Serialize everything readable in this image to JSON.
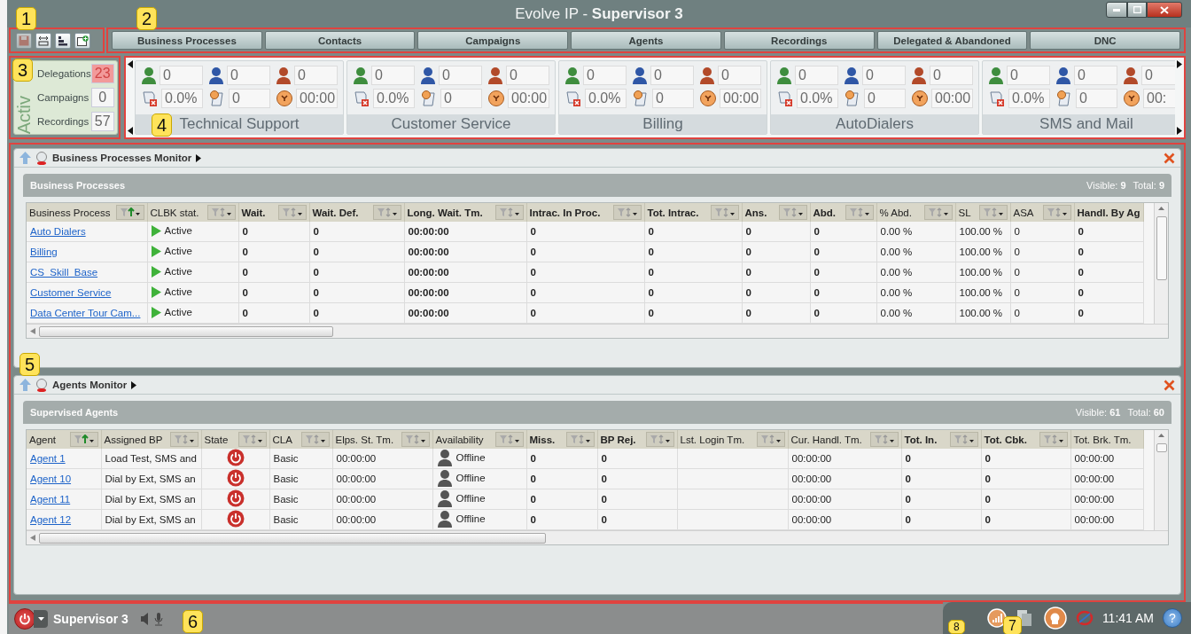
{
  "window": {
    "title": "Evolve IP - **Supervisor 3**"
  },
  "toolbar": {
    "buttons": [
      {
        "kind": "save",
        "disabled": true
      },
      {
        "kind": "fit",
        "disabled": false
      },
      {
        "kind": "bars",
        "disabled": false
      },
      {
        "kind": "new",
        "disabled": false
      }
    ]
  },
  "tabs": [
    {
      "label": "Business Processes"
    },
    {
      "label": "Contacts"
    },
    {
      "label": "Campaigns"
    },
    {
      "label": "Agents"
    },
    {
      "label": "Recordings"
    },
    {
      "label": "Delegated & Abandoned"
    },
    {
      "label": "DNC"
    }
  ],
  "active_panel": {
    "label": "Activ",
    "items": [
      {
        "label": "Delegations",
        "count": "23",
        "alert": true
      },
      {
        "label": "Campaigns",
        "count": "0",
        "alert": false
      },
      {
        "label": "Recordings",
        "count": "57",
        "alert": false
      }
    ]
  },
  "queues": [
    {
      "name": "Technical Support",
      "stats": [
        "0",
        "0",
        "0",
        "0.0%",
        "0",
        "00:00"
      ]
    },
    {
      "name": "Customer Service",
      "stats": [
        "0",
        "0",
        "0",
        "0.0%",
        "0",
        "00:00"
      ]
    },
    {
      "name": "Billing",
      "stats": [
        "0",
        "0",
        "0",
        "0.0%",
        "0",
        "00:00"
      ]
    },
    {
      "name": "AutoDialers",
      "stats": [
        "0",
        "0",
        "0",
        "0.0%",
        "0",
        "00:00"
      ]
    },
    {
      "name": "SMS and Mail",
      "stats": [
        "0",
        "0",
        "0",
        "0.0%",
        "0",
        "00:"
      ]
    }
  ],
  "monitors": [
    {
      "title": "Business Processes Monitor",
      "group": "Business Processes",
      "visible": "Visible: **9**",
      "total": "Total: **9**",
      "columns": [
        {
          "label": "Business Process",
          "kind": "link",
          "bold": false,
          "sorted": true
        },
        {
          "label": "CLBK stat.",
          "kind": "status",
          "bold": false,
          "sorted": false
        },
        {
          "label": "Wait.",
          "kind": "text",
          "bold": true,
          "sorted": false
        },
        {
          "label": "Wait. Def.",
          "kind": "text",
          "bold": true,
          "sorted": false
        },
        {
          "label": "Long. Wait. Tm.",
          "kind": "text",
          "bold": true,
          "sorted": false
        },
        {
          "label": "Intrac. In Proc.",
          "kind": "text",
          "bold": true,
          "sorted": false
        },
        {
          "label": "Tot. Intrac.",
          "kind": "text",
          "bold": true,
          "sorted": false
        },
        {
          "label": "Ans.",
          "kind": "text",
          "bold": true,
          "sorted": false
        },
        {
          "label": "Abd.",
          "kind": "text",
          "bold": true,
          "sorted": false
        },
        {
          "label": "% Abd.",
          "kind": "text",
          "bold": false,
          "sorted": false
        },
        {
          "label": "SL",
          "kind": "text",
          "bold": false,
          "sorted": false
        },
        {
          "label": "ASA",
          "kind": "text",
          "bold": false,
          "sorted": false
        },
        {
          "label": "Handl. By Ag",
          "kind": "text",
          "bold": true
        }
      ],
      "rows": [
        {
          "cells": [
            "Auto Dialers",
            "Active",
            "0",
            "0",
            "00:00:00",
            "0",
            "0",
            "0",
            "0",
            "0.00 %",
            "100.00 %",
            "0",
            "0"
          ]
        },
        {
          "cells": [
            "Billing",
            "Active",
            "0",
            "0",
            "00:00:00",
            "0",
            "0",
            "0",
            "0",
            "0.00 %",
            "100.00 %",
            "0",
            "0"
          ]
        },
        {
          "cells": [
            "CS_Skill_Base",
            "Active",
            "0",
            "0",
            "00:00:00",
            "0",
            "0",
            "0",
            "0",
            "0.00 %",
            "100.00 %",
            "0",
            "0"
          ]
        },
        {
          "cells": [
            "Customer Service",
            "Active",
            "0",
            "0",
            "00:00:00",
            "0",
            "0",
            "0",
            "0",
            "0.00 %",
            "100.00 %",
            "0",
            "0"
          ]
        },
        {
          "cells": [
            "Data Center Tour Cam...",
            "Active",
            "0",
            "0",
            "00:00:00",
            "0",
            "0",
            "0",
            "0",
            "0.00 %",
            "100.00 %",
            "0",
            "0"
          ]
        }
      ]
    },
    {
      "title": "Agents Monitor",
      "group": "Supervised Agents",
      "visible": "Visible: **61**",
      "total": "Total: **60**",
      "columns": [
        {
          "label": "Agent",
          "kind": "link",
          "bold": false,
          "sorted": true
        },
        {
          "label": "Assigned BP",
          "kind": "text",
          "bold": false,
          "sorted": false
        },
        {
          "label": "State",
          "kind": "state",
          "bold": false,
          "sorted": false
        },
        {
          "label": "CLA",
          "kind": "text",
          "bold": false,
          "sorted": false
        },
        {
          "label": "Elps. St. Tm.",
          "kind": "text",
          "bold": false,
          "sorted": false
        },
        {
          "label": "Availability",
          "kind": "availability",
          "bold": false,
          "sorted": false
        },
        {
          "label": "Miss.",
          "kind": "text",
          "bold": true,
          "sorted": false
        },
        {
          "label": "BP Rej.",
          "kind": "text",
          "bold": true,
          "sorted": false
        },
        {
          "label": "Lst. Login Tm.",
          "kind": "text",
          "bold": false,
          "sorted": false
        },
        {
          "label": "Cur. Handl. Tm.",
          "kind": "text",
          "bold": false,
          "sorted": false
        },
        {
          "label": "Tot. In.",
          "kind": "text",
          "bold": true,
          "sorted": false
        },
        {
          "label": "Tot. Cbk.",
          "kind": "text",
          "bold": true,
          "sorted": false
        },
        {
          "label": "Tot. Brk. Tm.",
          "kind": "text",
          "bold": false
        }
      ],
      "rows": [
        {
          "logged_in": false,
          "cells": [
            "Agent 1",
            "Load Test, SMS and",
            null,
            "Basic",
            "00:00:00",
            "Offline",
            "0",
            "0",
            null,
            "00:00:00",
            "0",
            "0",
            "00:00:00"
          ]
        },
        {
          "logged_in": false,
          "cells": [
            "Agent 10",
            "Dial by Ext, SMS an",
            null,
            "Basic",
            "00:00:00",
            "Offline",
            "0",
            "0",
            null,
            "00:00:00",
            "0",
            "0",
            "00:00:00"
          ]
        },
        {
          "logged_in": false,
          "cells": [
            "Agent 11",
            "Dial by Ext, SMS an",
            null,
            "Basic",
            "00:00:00",
            "Offline",
            "0",
            "0",
            null,
            "00:00:00",
            "0",
            "0",
            "00:00:00"
          ]
        },
        {
          "logged_in": false,
          "cells": [
            "Agent 12",
            "Dial by Ext, SMS an",
            null,
            "Basic",
            "00:00:00",
            "Offline",
            "0",
            "0",
            null,
            "00:00:00",
            "0",
            "0",
            "00:00:00"
          ]
        }
      ]
    }
  ],
  "status_bar": {
    "user": "Supervisor 3",
    "time": "11:41 AM",
    "help": "?"
  },
  "callouts": [
    "1",
    "2",
    "3",
    "4",
    "5",
    "6",
    "8",
    "7"
  ]
}
